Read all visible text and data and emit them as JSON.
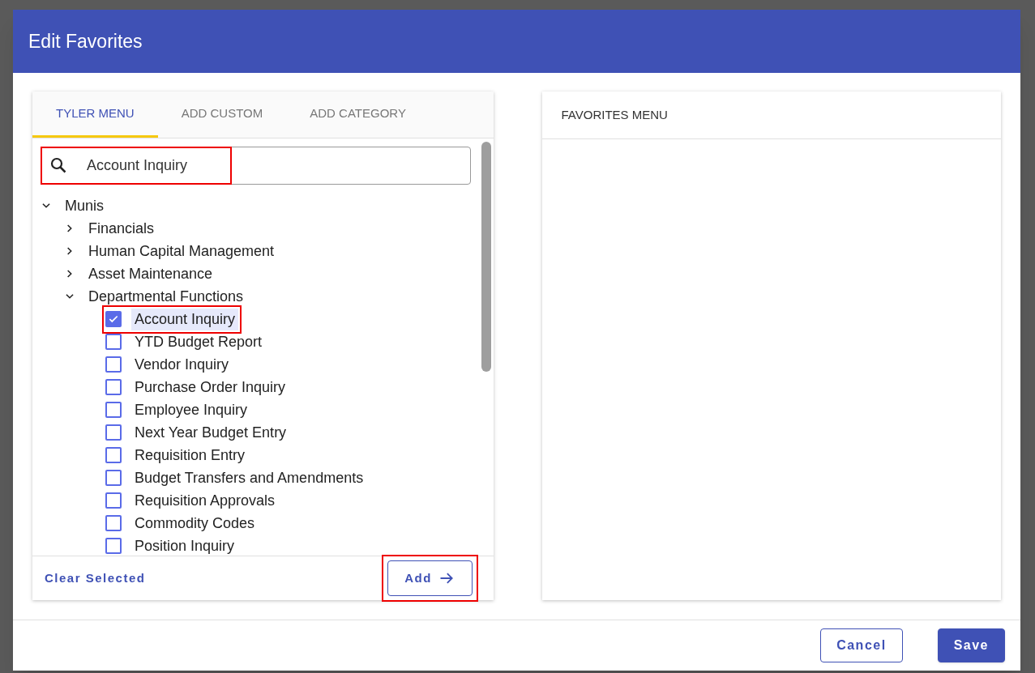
{
  "dialog": {
    "title": "Edit Favorites"
  },
  "tabs": [
    {
      "label": "TYLER MENU",
      "selected": true
    },
    {
      "label": "ADD CUSTOM",
      "selected": false
    },
    {
      "label": "ADD CATEGORY",
      "selected": false
    }
  ],
  "search": {
    "value": "Account Inquiry",
    "highlighted": true
  },
  "tree": [
    {
      "label": "Munis",
      "kind": "folder",
      "expanded": true,
      "children": [
        {
          "label": "Financials",
          "kind": "folder",
          "expanded": false
        },
        {
          "label": "Human Capital Management",
          "kind": "folder",
          "expanded": false
        },
        {
          "label": "Asset Maintenance",
          "kind": "folder",
          "expanded": false
        },
        {
          "label": "Departmental Functions",
          "kind": "folder",
          "expanded": true,
          "children": [
            {
              "label": "Account Inquiry",
              "kind": "checkbox",
              "checked": true,
              "highlighted": true
            },
            {
              "label": "YTD Budget Report",
              "kind": "checkbox",
              "checked": false,
              "highlighted": false
            },
            {
              "label": "Vendor Inquiry",
              "kind": "checkbox",
              "checked": false,
              "highlighted": false
            },
            {
              "label": "Purchase Order Inquiry",
              "kind": "checkbox",
              "checked": false,
              "highlighted": false
            },
            {
              "label": "Employee Inquiry",
              "kind": "checkbox",
              "checked": false,
              "highlighted": false
            },
            {
              "label": "Next Year Budget Entry",
              "kind": "checkbox",
              "checked": false,
              "highlighted": false
            },
            {
              "label": "Requisition Entry",
              "kind": "checkbox",
              "checked": false,
              "highlighted": false
            },
            {
              "label": "Budget Transfers and Amendments",
              "kind": "checkbox",
              "checked": false,
              "highlighted": false
            },
            {
              "label": "Requisition Approvals",
              "kind": "checkbox",
              "checked": false,
              "highlighted": false
            },
            {
              "label": "Commodity Codes",
              "kind": "checkbox",
              "checked": false,
              "highlighted": false
            },
            {
              "label": "Position Inquiry",
              "kind": "checkbox",
              "checked": false,
              "highlighted": false
            }
          ]
        }
      ]
    }
  ],
  "left_footer": {
    "clear_label": "Clear Selected",
    "add_label": "Add",
    "add_highlighted": true
  },
  "favorites": {
    "title": "FAVORITES MENU"
  },
  "buttons": [
    {
      "label": "Cancel",
      "kind": "outline"
    },
    {
      "label": "Save",
      "kind": "primary"
    }
  ]
}
